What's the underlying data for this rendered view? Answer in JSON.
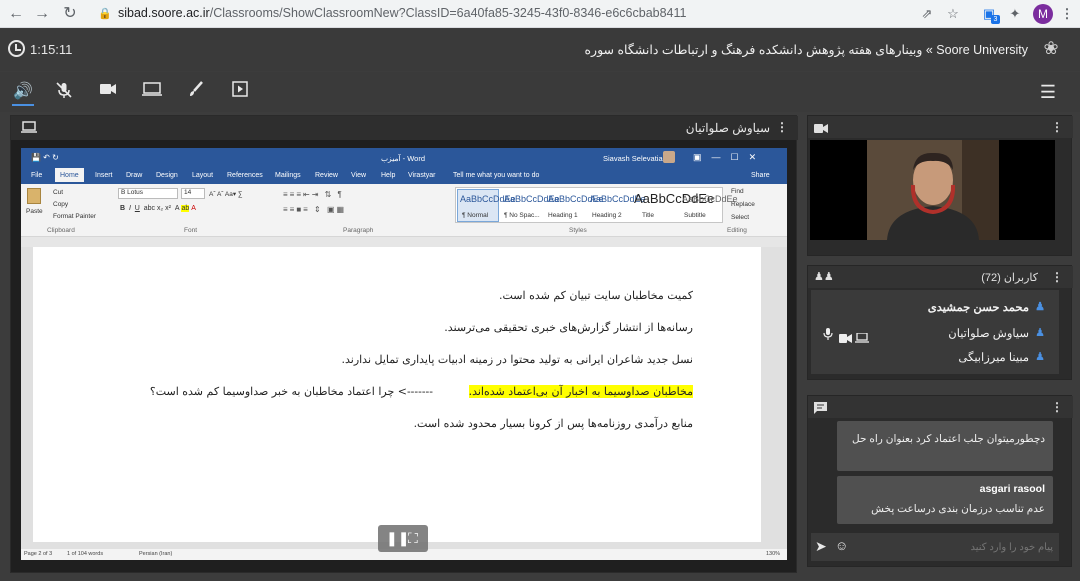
{
  "browser": {
    "url_host": "sibad.soore.ac.ir",
    "url_path": "/Classrooms/ShowClassroomNew?ClassID=6a40fa85-3245-43f0-8346-e6c6cbab8411",
    "profile_initial": "M",
    "extension_badge": "3"
  },
  "header": {
    "elapsed_time": "1:15:11",
    "breadcrumb": "Soore University » وبینارهای هفته پژوهش دانشکده فرهنگ و ارتباطات دانشگاه سوره"
  },
  "main_panel": {
    "presenter_name": "سیاوش صلواتیان"
  },
  "word": {
    "title": "آمیزب - Word",
    "user_name": "Siavash Selevatian",
    "tell_me": "Tell me what you want to do",
    "share": "Share",
    "tabs": [
      "File",
      "Home",
      "Insert",
      "Draw",
      "Design",
      "Layout",
      "References",
      "Mailings",
      "Review",
      "View",
      "Help",
      "Virastyar"
    ],
    "clipboard": {
      "paste": "Paste",
      "cut": "Cut",
      "copy": "Copy",
      "format_painter": "Format Painter",
      "group": "Clipboard"
    },
    "font": {
      "name": "B Lotus",
      "size": "14",
      "group": "Font"
    },
    "paragraph_group": "Paragraph",
    "styles": [
      {
        "preview": "AaBbCcDdEe",
        "name": "¶ Normal"
      },
      {
        "preview": "AaBbCcDdEe",
        "name": "¶ No Spac..."
      },
      {
        "preview": "AaBbCcDdEe",
        "name": "Heading 1"
      },
      {
        "preview": "AaBbCcDdEe",
        "name": "Heading 2"
      },
      {
        "preview": "AaBbCcDdEe",
        "name": "Title"
      },
      {
        "preview": "AaBbCcDdEe",
        "name": "Subtitle"
      }
    ],
    "styles_group": "Styles",
    "editing": {
      "find": "Find",
      "replace": "Replace",
      "select": "Select",
      "group": "Editing"
    },
    "doc_lines": [
      "کمیت مخاطبان سایت تبیان کم شده است.",
      "رسانه‌ها از انتشار گزارش‌های خبری تحقیقی می‌ترسند.",
      "نسل جدید شاعران ایرانی به تولید محتوا در زمینه ادبیات پایداری تمایل ندارند."
    ],
    "highlighted_line": "مخاطبان صداوسیما به اخبار آن بی‌اعتماد شده‌اند.",
    "arrow_text": "-------> چرا اعتماد مخاطبان به خبر صداوسیما کم شده است؟",
    "last_line": "منابع درآمدی روزنامه‌ها پس از کرونا بسیار محدود شده است.",
    "status": {
      "page": "Page 2 of 3",
      "words": "1 of 104 words",
      "language": "Persian (Iran)",
      "zoom": "130%"
    }
  },
  "users_panel": {
    "title": "کاربران (72)",
    "users": [
      {
        "name": "محمد حسن جمشیدی",
        "bold": true
      },
      {
        "name": "سیاوش صلواتیان",
        "bold": false
      },
      {
        "name": "مبینا میرزابیگی",
        "bold": false
      }
    ]
  },
  "chat_panel": {
    "messages": [
      {
        "author": "",
        "text": "دچطورمیتوان جلب اعتماد کرد بعنوان راه حل"
      },
      {
        "author": "asgari rasool",
        "text": "عدم تناسب  درزمان بندی  درساعت پخش"
      }
    ],
    "input_placeholder": "پیام خود را وارد کنید"
  },
  "colors": {
    "accent": "#4a90e2",
    "word_blue": "#2b579a",
    "highlight": "#ffff00"
  }
}
